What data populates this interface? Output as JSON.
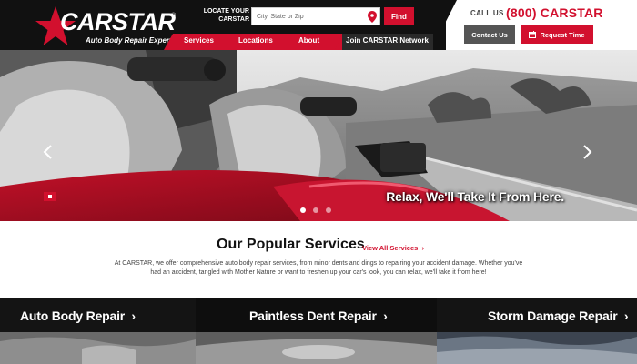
{
  "brand": {
    "name": "CARSTAR",
    "tagline": "Auto Body Repair Experts",
    "trademark": "®",
    "accent_color": "#d2102e",
    "dark_color": "#111111"
  },
  "locator": {
    "label": "LOCATE YOUR CARSTAR",
    "placeholder": "City, State or Zip",
    "pin_icon": "map-pin-icon",
    "find_label": "Find"
  },
  "nav": {
    "items": [
      {
        "label": "Services"
      },
      {
        "label": "Locations"
      },
      {
        "label": "About"
      },
      {
        "label": "Join CARSTAR Network"
      }
    ]
  },
  "contact": {
    "call_label": "CALL US",
    "phone": "(800) CARSTAR",
    "contact_label": "Contact Us",
    "request_label": "Request Time",
    "request_icon": "calendar-icon"
  },
  "hero": {
    "caption": "Relax, We'll Take It From Here.",
    "prev_icon": "chevron-left-icon",
    "next_icon": "chevron-right-icon",
    "slide_count": 3,
    "active_slide": 1
  },
  "services": {
    "heading": "Our Popular Services",
    "view_all_label": "View All Services",
    "intro": "At CARSTAR, we offer comprehensive auto body repair services, from minor dents and dings to repairing your accident damage. Whether you've had an accident, tangled with Mother Nature or want to freshen up your car's look, you can relax, we'll take it from here!",
    "tiles": [
      {
        "title": "Auto Body Repair"
      },
      {
        "title": "Paintless Dent Repair"
      },
      {
        "title": "Storm Damage Repair"
      }
    ]
  }
}
